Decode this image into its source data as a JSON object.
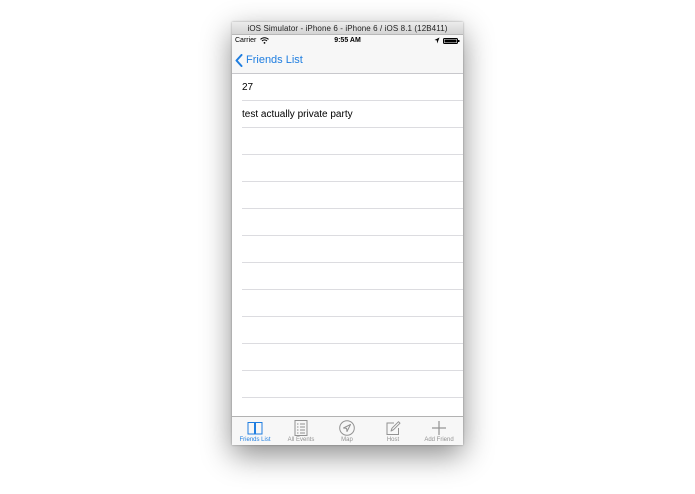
{
  "window": {
    "title": "iOS Simulator - iPhone 6 - iPhone 6 / iOS 8.1 (12B411)"
  },
  "status_bar": {
    "carrier": "Carrier",
    "time": "9:55 AM"
  },
  "nav": {
    "back_label": "Friends List"
  },
  "rows": [
    {
      "label": "27"
    },
    {
      "label": "test actually private party"
    },
    {
      "label": ""
    },
    {
      "label": ""
    },
    {
      "label": ""
    },
    {
      "label": ""
    },
    {
      "label": ""
    },
    {
      "label": ""
    },
    {
      "label": ""
    },
    {
      "label": ""
    },
    {
      "label": ""
    },
    {
      "label": ""
    }
  ],
  "tabs": [
    {
      "label": "Friends List",
      "icon": "book-icon",
      "active": true
    },
    {
      "label": "All Events",
      "icon": "list-icon",
      "active": false
    },
    {
      "label": "Map",
      "icon": "navigation-arrow-icon",
      "active": false
    },
    {
      "label": "Host",
      "icon": "compose-icon",
      "active": false
    },
    {
      "label": "Add Friend",
      "icon": "plus-icon",
      "active": false
    }
  ],
  "colors": {
    "accent": "#1f7ee0",
    "inactive": "#929292",
    "bar_bg": "#f7f7f7",
    "separator": "#dcdce0"
  }
}
